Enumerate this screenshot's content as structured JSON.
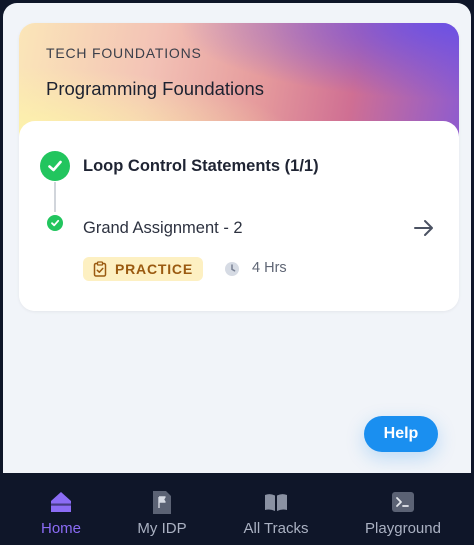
{
  "course_card": {
    "eyebrow": "TECH FOUNDATIONS",
    "title": "Programming Foundations",
    "module_title": "Loop Control Statements (1/1)",
    "item_title": "Grand Assignment - 2",
    "badge_label": "PRACTICE",
    "duration": "4 Hrs",
    "icons": [
      "check-circle-icon",
      "arrow-right-icon",
      "clipboard-check-icon",
      "clock-icon"
    ]
  },
  "help_button": {
    "label": "Help"
  },
  "bottom_nav": {
    "items": [
      {
        "label": "Home",
        "icon": "home-icon",
        "active": true
      },
      {
        "label": "My IDP",
        "icon": "flag-document-icon",
        "active": false
      },
      {
        "label": "All Tracks",
        "icon": "open-book-icon",
        "active": false
      },
      {
        "label": "Playground",
        "icon": "terminal-icon",
        "active": false
      }
    ]
  },
  "colors": {
    "success": "#22c55e",
    "accent": "#8b6cf5",
    "help": "#1a8ff0",
    "nav_bg": "#0f1629",
    "badge_bg": "#fdf0c2",
    "badge_text": "#9a5a10"
  }
}
